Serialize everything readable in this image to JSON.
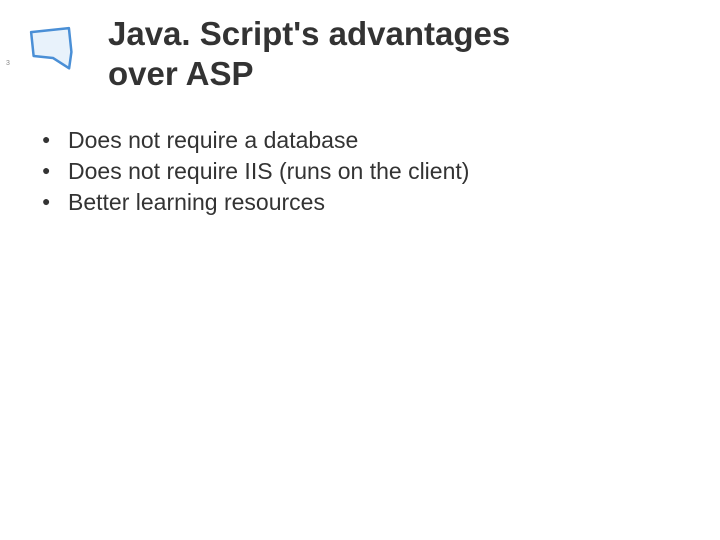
{
  "slide_number": "3",
  "title_line1": "Java. Script's advantages",
  "title_line2": "over ASP",
  "bullets": [
    "Does not require a database",
    "Does not require IIS (runs on the client)",
    "Better learning resources"
  ]
}
